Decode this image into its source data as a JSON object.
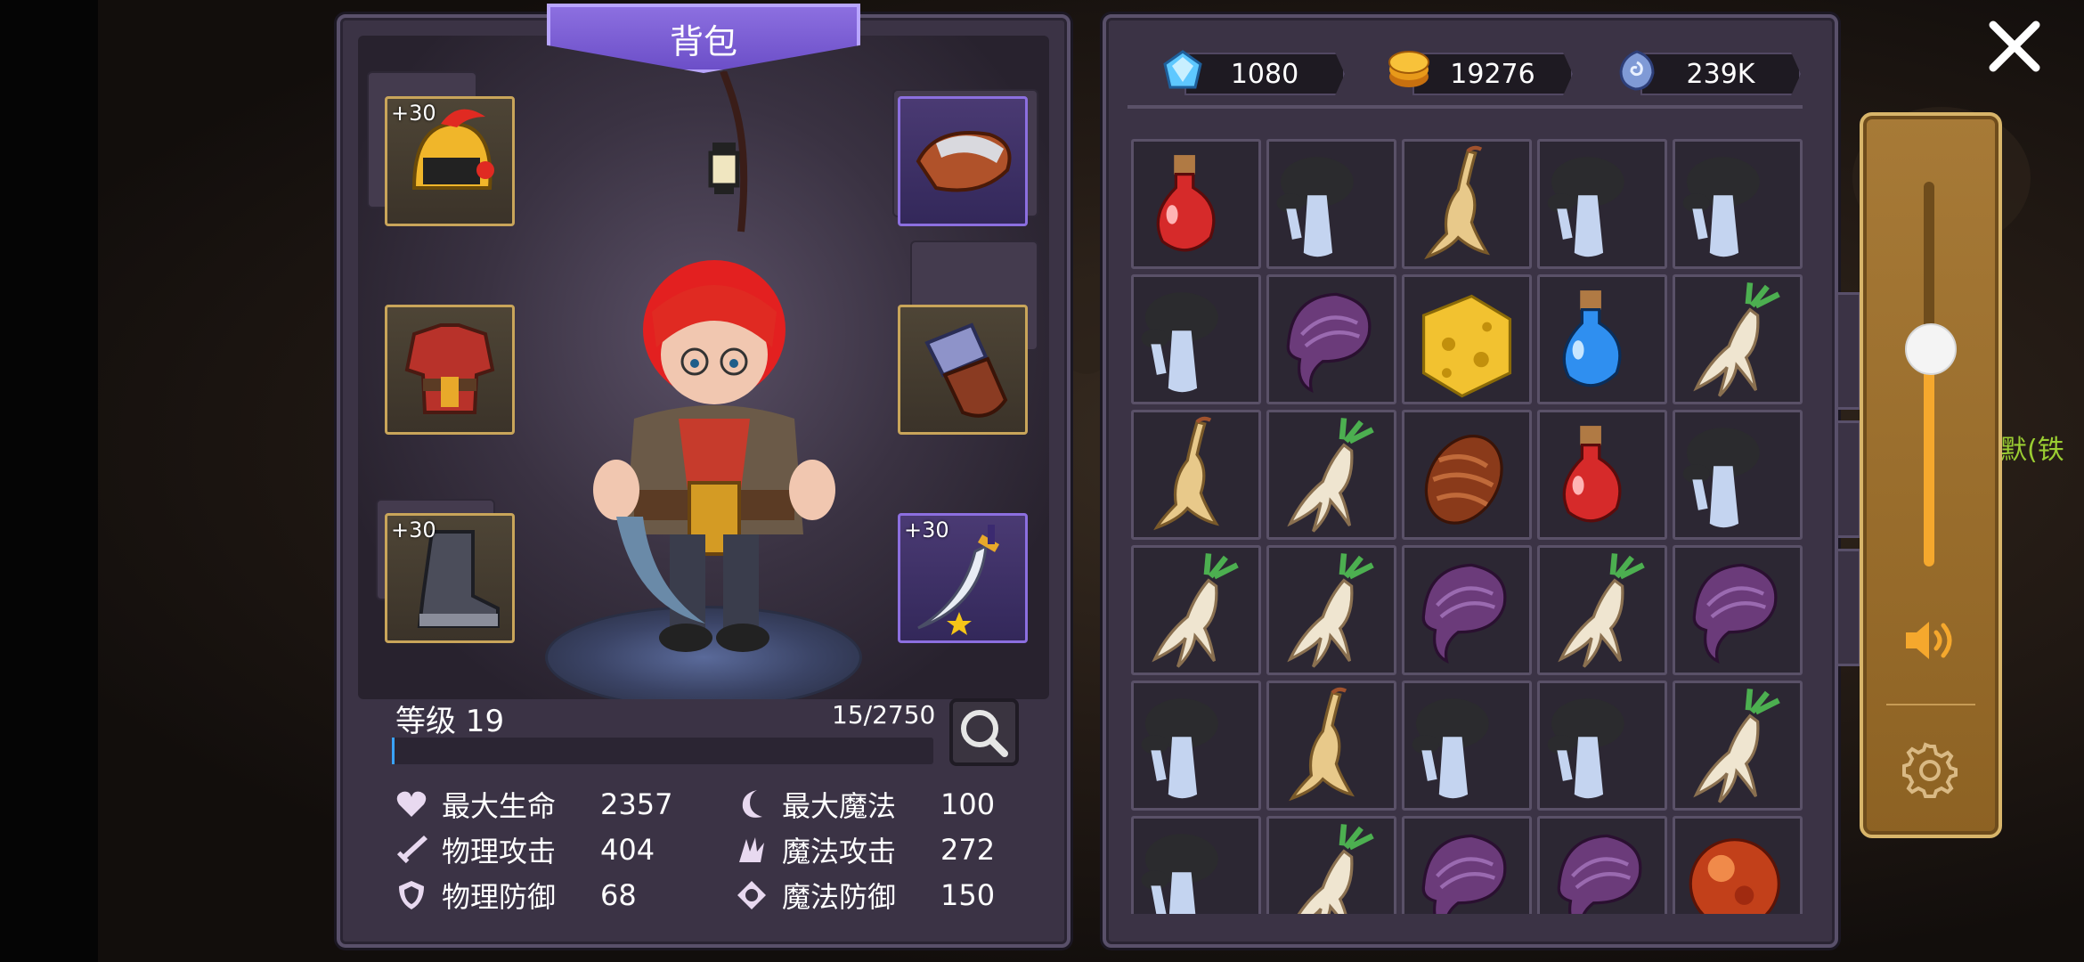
{
  "panel_title": "背包",
  "equipment": {
    "helmet": {
      "enhance": "+30"
    },
    "armor": {
      "enhance": ""
    },
    "boots": {
      "enhance": "+30"
    },
    "bracer": {
      "enhance": ""
    },
    "gloves": {
      "enhance": ""
    },
    "weapon": {
      "enhance": "+30"
    }
  },
  "level": {
    "label": "等级 19",
    "exp_text": "15/2750",
    "exp_fraction": 0.0055
  },
  "stats": [
    {
      "label": "最大生命",
      "value": "2357",
      "icon": "heart-icon"
    },
    {
      "label": "物理攻击",
      "value": "404",
      "icon": "sword-icon"
    },
    {
      "label": "物理防御",
      "value": "68",
      "icon": "shield-icon"
    },
    {
      "label": "最大魔法",
      "value": "100",
      "icon": "moon-icon"
    },
    {
      "label": "魔法攻击",
      "value": "272",
      "icon": "magic-claw-icon"
    },
    {
      "label": "魔法防御",
      "value": "150",
      "icon": "magic-shield-icon"
    }
  ],
  "currency": [
    {
      "name": "diamond-icon",
      "value": "1080"
    },
    {
      "name": "gold-coin-icon",
      "value": "19276"
    },
    {
      "name": "soul-stone-icon",
      "value": "239K"
    }
  ],
  "inventory": [
    "red-potion-icon",
    "mushroom-icon",
    "ginseng-root-icon",
    "mushroom-icon",
    "mushroom-icon",
    "mushroom-icon",
    "lingzhi-icon",
    "cheese-icon",
    "blue-potion-icon",
    "mandrake-icon",
    "ginseng-root-icon",
    "mandrake-icon",
    "cocoon-icon",
    "red-potion-icon",
    "mushroom-icon",
    "mandrake-icon",
    "mandrake-icon",
    "lingzhi-icon",
    "mandrake-icon",
    "lingzhi-icon",
    "mushroom-icon",
    "ginseng-root-icon",
    "mushroom-icon",
    "mushroom-icon",
    "mandrake-icon",
    "mushroom-icon",
    "mandrake-icon",
    "lingzhi-icon",
    "lingzhi-icon",
    "fire-orb-icon"
  ],
  "volume_level": 0.57,
  "background_text": "默(铁",
  "colors": {
    "panel": "#3b3345",
    "banner": "#7a5cd6",
    "slot_gold": "#c9a55a",
    "slot_purple": "#8c6fe0",
    "exp_bar": "#39a3ff",
    "volume_accent": "#f5a82d"
  }
}
